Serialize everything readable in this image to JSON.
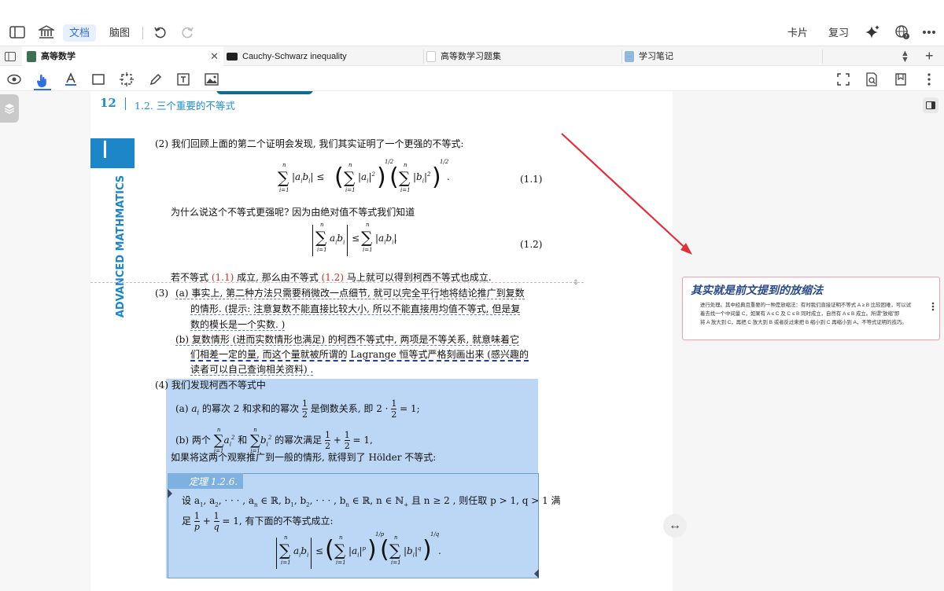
{
  "toolbar": {
    "doc_label": "文档",
    "mind_label": "脑图",
    "card_label": "卡片",
    "review_label": "复习"
  },
  "tabs": [
    {
      "label": "高等数学",
      "active": true
    },
    {
      "label": "Cauchy-Schwarz inequality",
      "active": false
    },
    {
      "label": "高等数学习题集",
      "active": false
    },
    {
      "label": "学习笔记",
      "active": false
    }
  ],
  "page": {
    "page_number": "12",
    "section_title": "1.2.  三个重要的不等式",
    "side_banner": "ADVANCED MATHMATICS",
    "side_letter": "I",
    "p2_intro": "(2) 我们回顾上面的第二个证明会发现, 我们其实证明了一个更强的不等式:",
    "eq_1_1_tag": "(1.1)",
    "why_line": "为什么说这个不等式更强呢? 因为由绝对值不等式我们知道",
    "eq_1_2_tag": "(1.2)",
    "eq_1_2_tail": ",",
    "conclusion_a": "若不等式 ",
    "conclusion_ref1": "(1.1)",
    "conclusion_b": " 成立, 那么由不等式 ",
    "conclusion_ref2": "(1.2)",
    "conclusion_c": " 马上就可以得到柯西不等式也成立.",
    "p3_num": "(3)",
    "p3a_1": "(a) 事实上, 第二种方法只需要稍微改一点细节, 就可以完全平行地将结论推广到复数",
    "p3a_2": "的情形. (提示: 注意复数不能直接比较大小, 所以不能直接用均值不等式, 但是复",
    "p3a_3": "数的模长是一个实数. )",
    "p3b_1": "(b) 复数情形 (进而实数情形也满足) 的柯西不等式中, 两项是不等关系, 就意味着它",
    "p3b_2": "们相差一定的量, 而这个量就被所谓的 Lagrange 恒等式严格刻画出来 (感兴趣的",
    "p3b_3": "读者可以自己查询相关资料) .",
    "p4_title": "(4) 我们发现柯西不等式中",
    "p4a_1": "(a) ",
    "p4a_2": " 的幂次 2 和求和的幂次 ",
    "p4a_3": " 是倒数关系, 即 2 · ",
    "p4a_4": " = 1;",
    "p4a_ai": "a",
    "p4a_i": "i",
    "p4b_1": "(b) 两个 ",
    "p4b_2": " 和 ",
    "p4b_3": " 的幂次满足 ",
    "p4b_4": " = 1,",
    "generalize": "如果将这两个观察推广到一般的情形, 就得到了 Hölder 不等式:",
    "theorem_label": "定理 1.2.6.",
    "thm_1a": "设 a",
    "thm_1b": ", a",
    "thm_1c": ", · · · , a",
    "thm_1d": " ∈ ℝ, b",
    "thm_1e": ", b",
    "thm_1f": ", · · · , b",
    "thm_1g": " ∈ ℝ, n ∈ ℕ",
    "thm_1h": " 且 n ≥ 2 , 则任取 p > 1, q > 1 满",
    "thm_2a": "足 ",
    "thm_2b": " = 1, 有下面的不等式成立:",
    "sub_1": "1",
    "sub_2": "2",
    "sub_n": "n",
    "sub_plus": "+",
    "sub_i": "i",
    "sup_n": "n",
    "sup_2": "2",
    "sup_p": "p",
    "sup_q": "q",
    "sup_half": "1/2",
    "sup_1p": "1/p",
    "sup_1q": "1/q",
    "sum_sym": "∑",
    "one": "1",
    "two": "2",
    "p_var": "p",
    "q_var": "q",
    "plus": "+",
    "leq": "≤",
    "dot": ".",
    "comma": ","
  },
  "note_card": {
    "title": "其实就是前文提到的放缩法",
    "line1": "进行处理。其中经典且重要的一种是放缩法：有时我们直接证明不等式 A ≥ B 比较困难，可以试",
    "line2": "着去找一个中间量 C，如果有 A ≤ C 及 C ≤ B 同时成立，自然有 A ≤ B 成立。所谓“放缩”即",
    "line3": "将 A 放大到 C，再把 C 放大到 B 或者反过来把 B 缩小到 C 再缩小到 A，不等式证明的技巧。"
  },
  "colors": {
    "accent": "#1c8fd6",
    "banner": "#1d86c9",
    "highlight": "#bcd7f5",
    "arrow": "#e0303a",
    "card_border": "#f0a0a8",
    "ref": "#c0392b"
  }
}
